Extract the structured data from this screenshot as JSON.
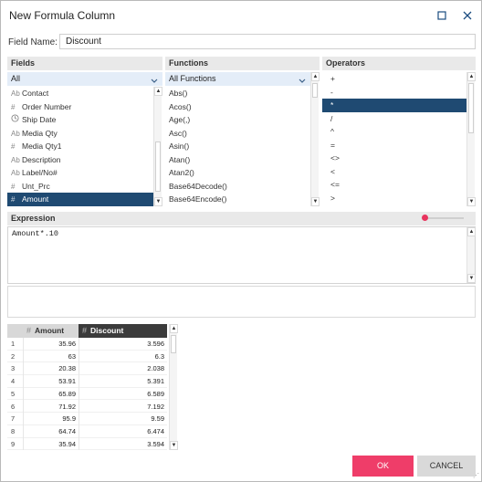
{
  "window": {
    "title": "New Formula Column",
    "maximize_icon": "maximize-icon",
    "close_icon": "close-icon"
  },
  "field_name": {
    "label": "Field Name:",
    "value": "Discount"
  },
  "fields": {
    "header": "Fields",
    "filter_value": "All",
    "items": [
      {
        "type_icon": "Ab",
        "label": "Contact"
      },
      {
        "type_icon": "#",
        "label": "Order Number"
      },
      {
        "type_icon": "clock",
        "label": "Ship Date"
      },
      {
        "type_icon": "Ab",
        "label": "Media Qty"
      },
      {
        "type_icon": "#",
        "label": "Media Qty1"
      },
      {
        "type_icon": "Ab",
        "label": "Description"
      },
      {
        "type_icon": "Ab",
        "label": "Label/No#"
      },
      {
        "type_icon": "#",
        "label": "Unt_Prc"
      },
      {
        "type_icon": "#",
        "label": "Amount",
        "selected": true
      }
    ]
  },
  "functions": {
    "header": "Functions",
    "filter_value": "All Functions",
    "items": [
      "Abs()",
      "Acos()",
      "Age(,)",
      "Asc()",
      "Asin()",
      "Atan()",
      "Atan2()",
      "Base64Decode()",
      "Base64Encode()"
    ]
  },
  "operators": {
    "header": "Operators",
    "items": [
      "+",
      "-",
      "*",
      "/",
      "^",
      "=",
      "<>",
      "<",
      "<=",
      ">"
    ],
    "selected_index": 2
  },
  "expression": {
    "header": "Expression",
    "text": "Amount*.10"
  },
  "colors": {
    "accent": "#ef3d69",
    "selection": "#1f4a72",
    "filter_bg": "#e4edf8"
  },
  "preview_grid": {
    "columns": [
      {
        "icon": "#",
        "label": "Amount"
      },
      {
        "icon": "#",
        "label": "Discount"
      }
    ],
    "rows": [
      {
        "idx": "1",
        "amount": "35.96",
        "discount": "3.596"
      },
      {
        "idx": "2",
        "amount": "63",
        "discount": "6.3"
      },
      {
        "idx": "3",
        "amount": "20.38",
        "discount": "2.038"
      },
      {
        "idx": "4",
        "amount": "53.91",
        "discount": "5.391"
      },
      {
        "idx": "5",
        "amount": "65.89",
        "discount": "6.589"
      },
      {
        "idx": "6",
        "amount": "71.92",
        "discount": "7.192"
      },
      {
        "idx": "7",
        "amount": "95.9",
        "discount": "9.59"
      },
      {
        "idx": "8",
        "amount": "64.74",
        "discount": "6.474"
      },
      {
        "idx": "9",
        "amount": "35.94",
        "discount": "3.594"
      }
    ]
  },
  "buttons": {
    "ok": "OK",
    "cancel": "CANCEL"
  }
}
